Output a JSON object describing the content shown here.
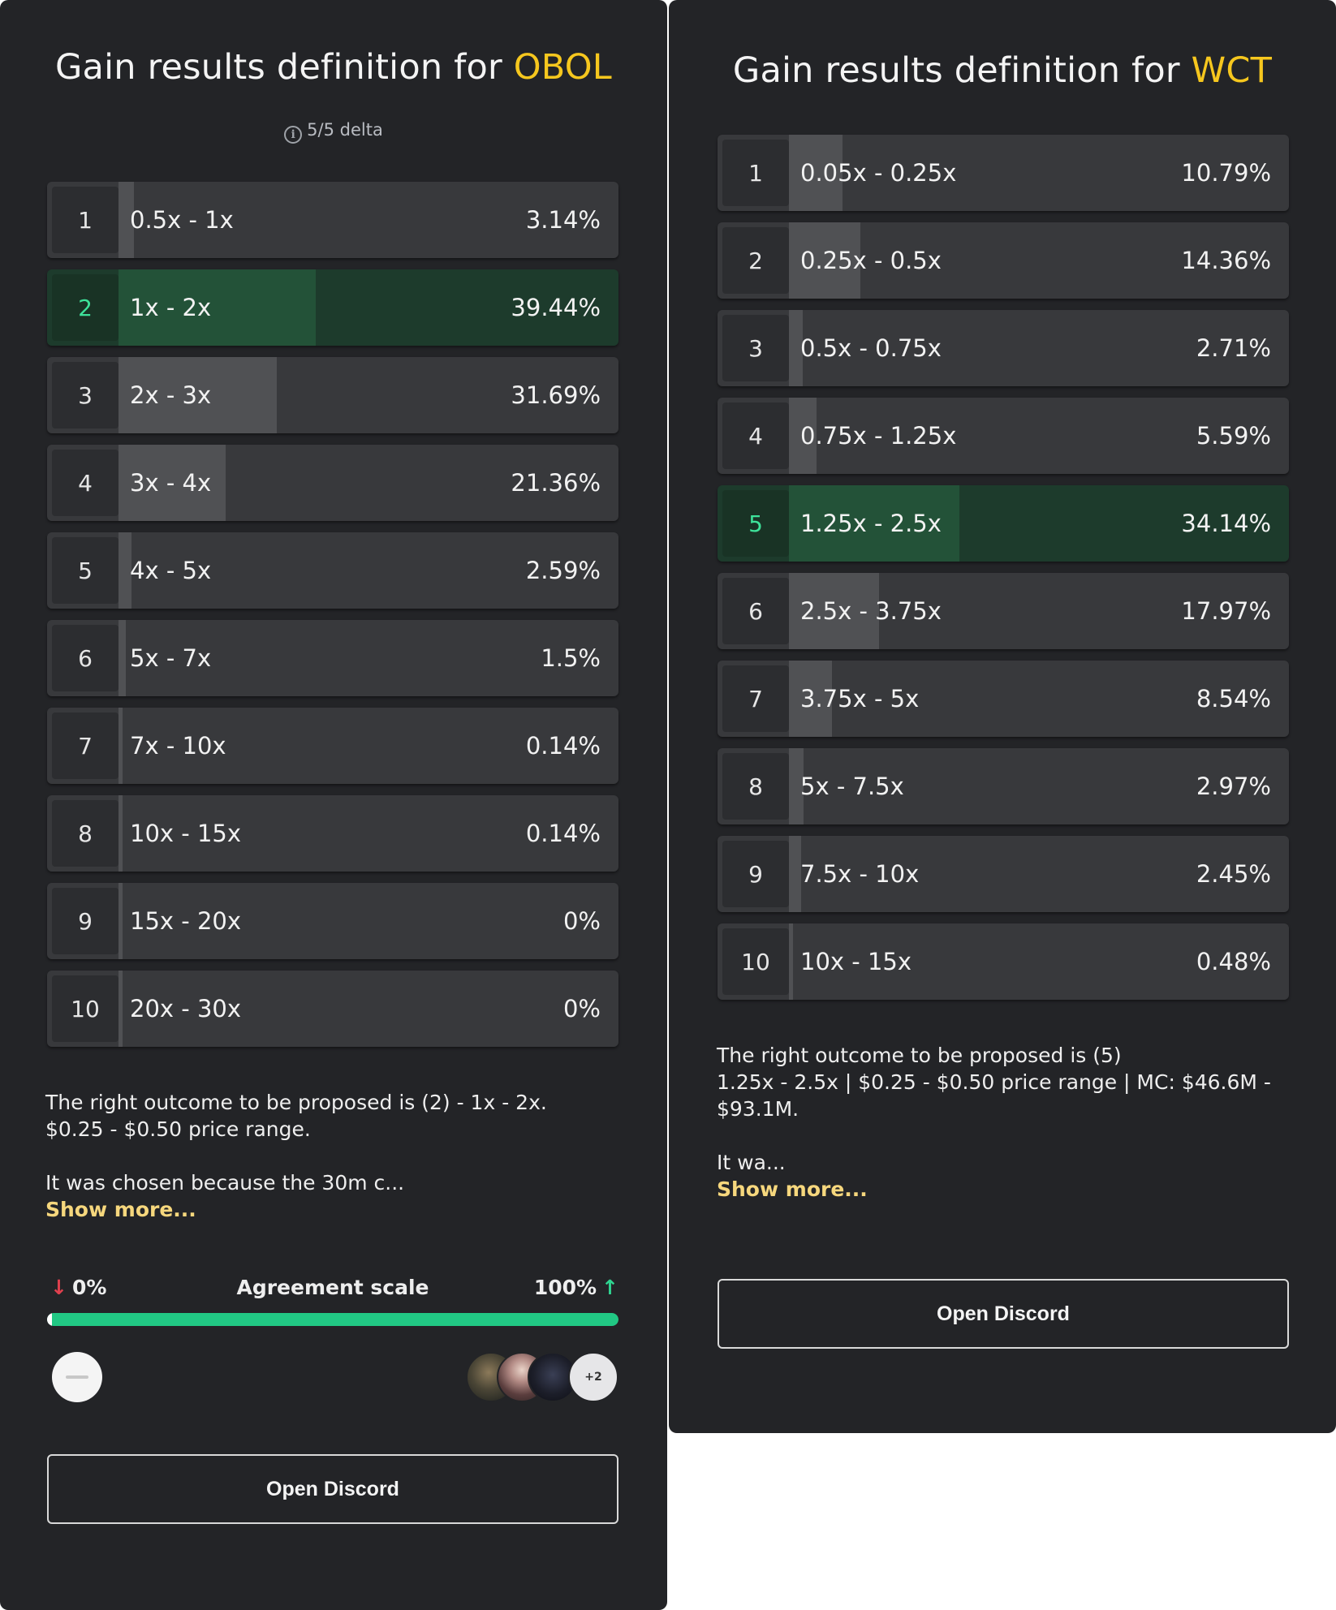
{
  "panels": [
    {
      "title_prefix": "Gain results definition for ",
      "token": "OBOL",
      "delta": "5/5 delta",
      "info_icon": "info-icon",
      "rows": [
        {
          "num": "1",
          "range": "0.5x - 1x",
          "pct": "3.14%",
          "value": 3.14
        },
        {
          "num": "2",
          "range": "1x - 2x",
          "pct": "39.44%",
          "value": 39.44,
          "selected": true
        },
        {
          "num": "3",
          "range": "2x - 3x",
          "pct": "31.69%",
          "value": 31.69
        },
        {
          "num": "4",
          "range": "3x - 4x",
          "pct": "21.36%",
          "value": 21.36
        },
        {
          "num": "5",
          "range": "4x - 5x",
          "pct": "2.59%",
          "value": 2.59
        },
        {
          "num": "6",
          "range": "5x - 7x",
          "pct": "1.5%",
          "value": 1.5
        },
        {
          "num": "7",
          "range": "7x - 10x",
          "pct": "0.14%",
          "value": 0.14
        },
        {
          "num": "8",
          "range": "10x - 15x",
          "pct": "0.14%",
          "value": 0.14
        },
        {
          "num": "9",
          "range": "15x - 20x",
          "pct": "0%",
          "value": 0
        },
        {
          "num": "10",
          "range": "20x - 30x",
          "pct": "0%",
          "value": 0
        }
      ],
      "outcome_line1": "The right outcome to be proposed is (2) - 1x - 2x.",
      "outcome_line2": "$0.25 - $0.50 price range.",
      "reason": "It was chosen because the 30m c...",
      "show_more": "Show more...",
      "agreement": {
        "label": "Agreement scale",
        "min_label": "0%",
        "max_label": "100%",
        "value_percent": 100,
        "more_voters": "+2"
      },
      "discord_button": "Open Discord"
    },
    {
      "title_prefix": "Gain results definition for ",
      "token": "WCT",
      "rows": [
        {
          "num": "1",
          "range": "0.05x - 0.25x",
          "pct": "10.79%",
          "value": 10.79
        },
        {
          "num": "2",
          "range": "0.25x - 0.5x",
          "pct": "14.36%",
          "value": 14.36
        },
        {
          "num": "3",
          "range": "0.5x - 0.75x",
          "pct": "2.71%",
          "value": 2.71
        },
        {
          "num": "4",
          "range": "0.75x - 1.25x",
          "pct": "5.59%",
          "value": 5.59
        },
        {
          "num": "5",
          "range": "1.25x - 2.5x",
          "pct": "34.14%",
          "value": 34.14,
          "selected": true
        },
        {
          "num": "6",
          "range": "2.5x - 3.75x",
          "pct": "17.97%",
          "value": 17.97
        },
        {
          "num": "7",
          "range": "3.75x - 5x",
          "pct": "8.54%",
          "value": 8.54
        },
        {
          "num": "8",
          "range": "5x - 7.5x",
          "pct": "2.97%",
          "value": 2.97
        },
        {
          "num": "9",
          "range": "7.5x - 10x",
          "pct": "2.45%",
          "value": 2.45
        },
        {
          "num": "10",
          "range": "10x - 15x",
          "pct": "0.48%",
          "value": 0.48
        }
      ],
      "outcome_line1": "The right outcome to be proposed is (5)",
      "outcome_line2": "1.25x - 2.5x | $0.25 - $0.50 price range | MC: $46.6M - $93.1M.",
      "reason": "It wa...",
      "show_more": "Show more...",
      "discord_button": "Open Discord"
    }
  ],
  "colors": {
    "panel_bg": "#232427",
    "row_bg": "#38393c",
    "row_fill": "#505154",
    "selected_bg": "#1d3b2c",
    "selected_fill": "#235238",
    "selected_num": "#3ee29a",
    "token_accent": "#f6c71e",
    "show_more": "#f6d77d",
    "agreement_bar": "#21c884"
  }
}
